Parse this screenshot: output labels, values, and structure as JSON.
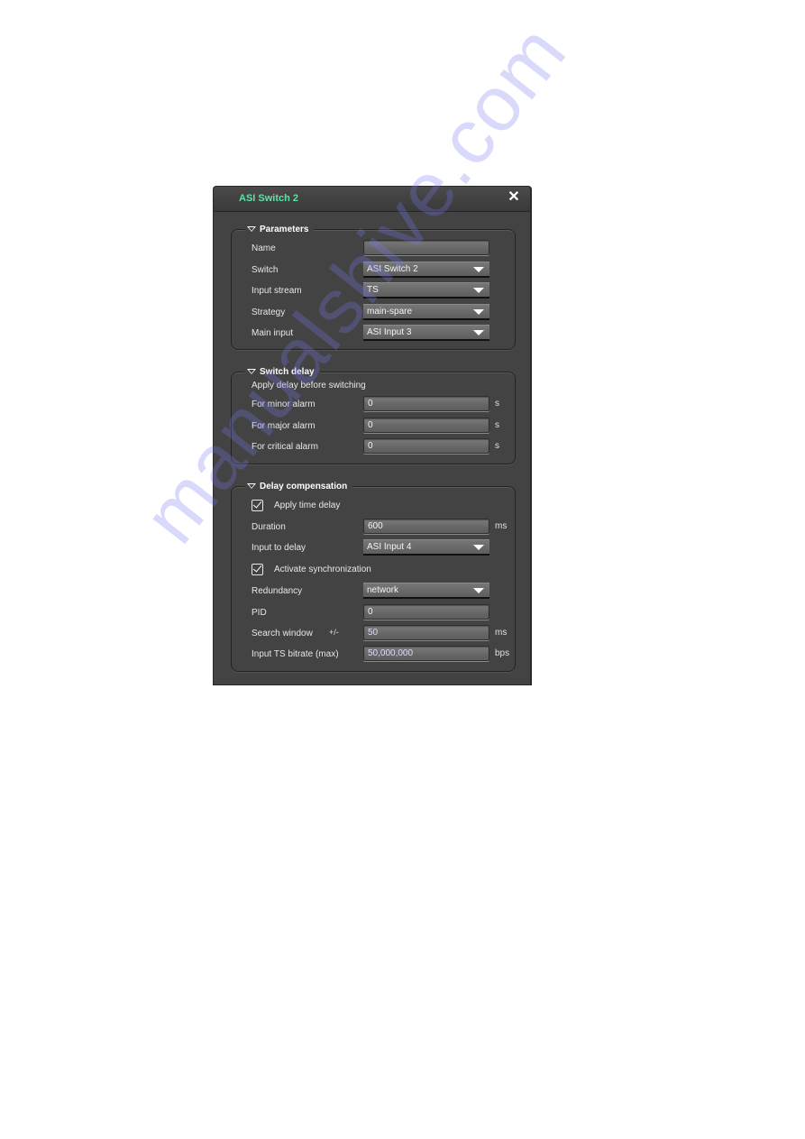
{
  "dialog": {
    "title": "ASI Switch 2",
    "close_icon": "close-icon"
  },
  "parameters": {
    "legend": "Parameters",
    "name": {
      "label": "Name",
      "value": ""
    },
    "switch": {
      "label": "Switch",
      "value": "ASI Switch 2"
    },
    "input_stream": {
      "label": "Input stream",
      "value": "TS"
    },
    "strategy": {
      "label": "Strategy",
      "value": "main-spare"
    },
    "main_input": {
      "label": "Main input",
      "value": "ASI Input 3"
    }
  },
  "switch_delay": {
    "legend": "Switch delay",
    "description": "Apply delay before switching",
    "minor": {
      "label": "For minor alarm",
      "value": "0",
      "unit": "s"
    },
    "major": {
      "label": "For major alarm",
      "value": "0",
      "unit": "s"
    },
    "critical": {
      "label": "For critical alarm",
      "value": "0",
      "unit": "s"
    }
  },
  "delay_compensation": {
    "legend": "Delay compensation",
    "apply_time_delay": {
      "label": "Apply time delay",
      "checked": true
    },
    "duration": {
      "label": "Duration",
      "value": "600",
      "unit": "ms"
    },
    "input_to_delay": {
      "label": "Input to delay",
      "value": "ASI Input 4"
    },
    "activate_sync": {
      "label": "Activate synchronization",
      "checked": true
    },
    "redundancy": {
      "label": "Redundancy",
      "value": "network"
    },
    "pid": {
      "label": "PID",
      "value": "0"
    },
    "search_window": {
      "label": "Search window",
      "prefix": "+/-",
      "value": "50",
      "unit": "ms"
    },
    "bitrate": {
      "label": "Input TS bitrate (max)",
      "value": "50,000,000",
      "unit": "bps"
    }
  },
  "watermark": "manualshive.com",
  "colors": {
    "title": "#5fe0a6",
    "panel": "#434343",
    "watermark": "#7878f0"
  }
}
